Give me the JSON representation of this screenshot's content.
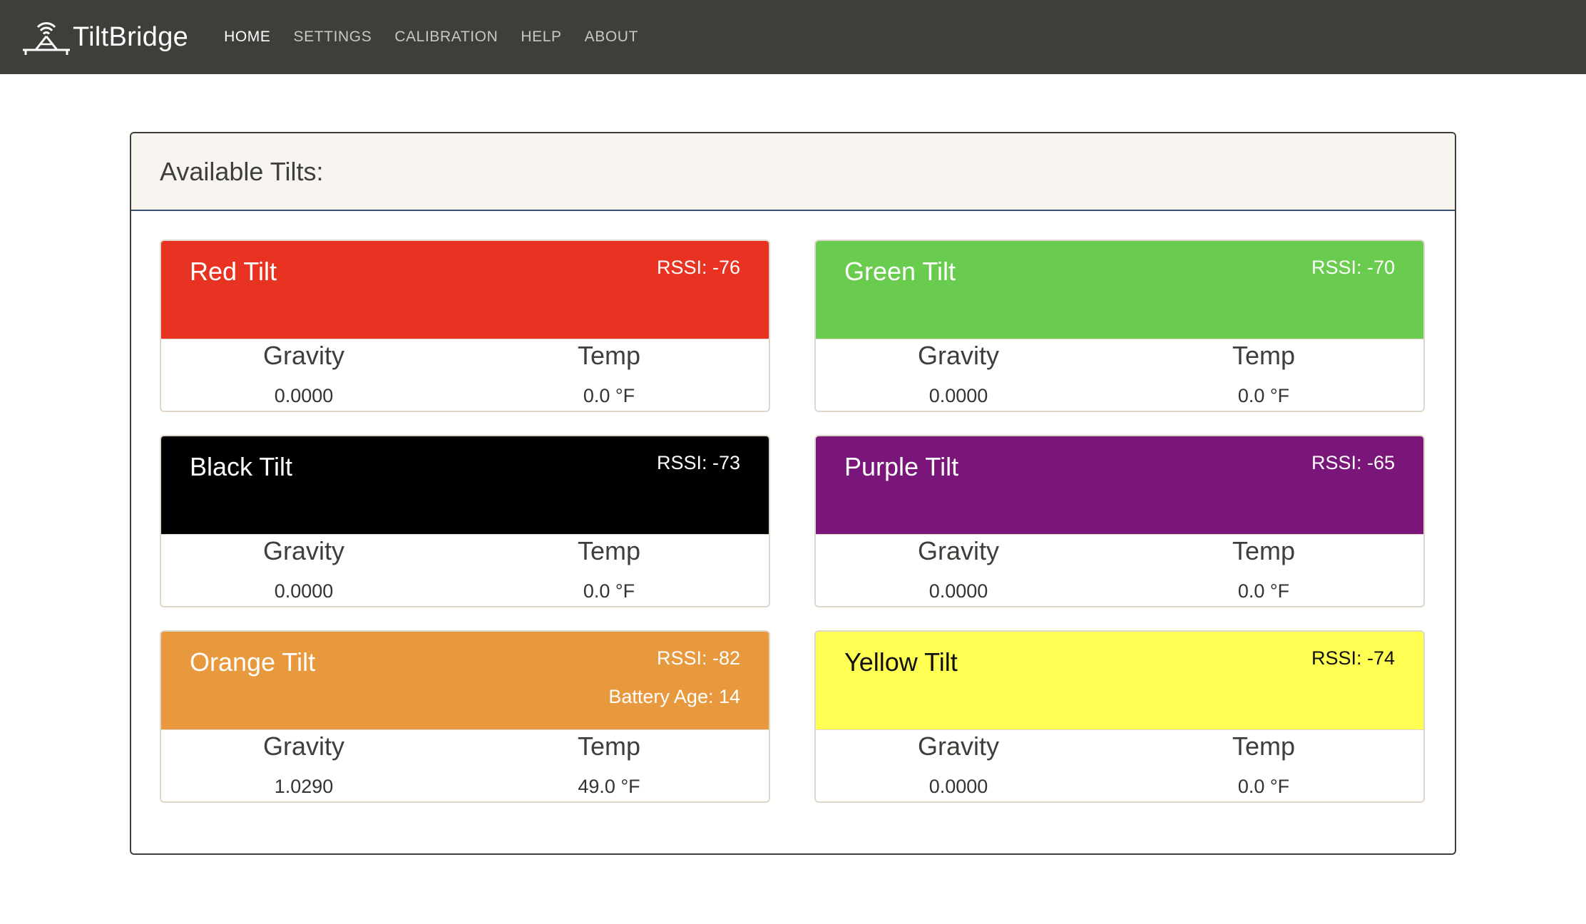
{
  "nav": {
    "brand": "TiltBridge",
    "links": [
      "HOME",
      "SETTINGS",
      "CALIBRATION",
      "HELP",
      "ABOUT"
    ],
    "active": "HOME"
  },
  "panel": {
    "title": "Available Tilts:"
  },
  "labels": {
    "gravity": "Gravity",
    "temp": "Temp"
  },
  "tilts": [
    {
      "name": "Red Tilt",
      "rssi": "RSSI: -76",
      "gravity": "0.0000",
      "temp": "0.0 °F",
      "color": "#e83323"
    },
    {
      "name": "Green Tilt",
      "rssi": "RSSI: -70",
      "gravity": "0.0000",
      "temp": "0.0 °F",
      "color": "#69cc4e"
    },
    {
      "name": "Black Tilt",
      "rssi": "RSSI: -73",
      "gravity": "0.0000",
      "temp": "0.0 °F",
      "color": "#000000"
    },
    {
      "name": "Purple Tilt",
      "rssi": "RSSI: -65",
      "gravity": "0.0000",
      "temp": "0.0 °F",
      "color": "#7a1679"
    },
    {
      "name": "Orange Tilt",
      "rssi": "RSSI: -82",
      "battery": "Battery Age: 14",
      "gravity": "1.0290",
      "temp": "49.0 °F",
      "color": "#e9993d"
    },
    {
      "name": "Yellow Tilt",
      "rssi": "RSSI: -74",
      "gravity": "0.0000",
      "temp": "0.0 °F",
      "color": "#ffff54"
    }
  ],
  "icons": {
    "brand_logo": "tilt-bridge-logo-icon"
  }
}
